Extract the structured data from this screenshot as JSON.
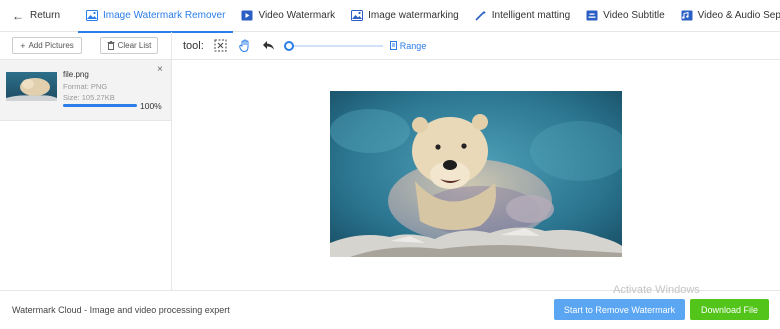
{
  "header": {
    "return_label": "Return",
    "tabs": [
      {
        "label": "Image Watermark Remover",
        "icon": "image-icon",
        "active": true
      },
      {
        "label": "Video Watermark",
        "icon": "video-icon",
        "active": false
      },
      {
        "label": "Image watermarking",
        "icon": "image-icon",
        "active": false
      },
      {
        "label": "Intelligent matting",
        "icon": "magic-wand-icon",
        "active": false
      },
      {
        "label": "Video Subtitle",
        "icon": "subtitle-icon",
        "active": false
      },
      {
        "label": "Video & Audio Separation",
        "icon": "separation-icon",
        "active": false
      }
    ]
  },
  "sidebar": {
    "add_label": "Add Pictures",
    "clear_label": "Clear List",
    "files": [
      {
        "name": "file.png",
        "format": "Format:  PNG",
        "size": "Size:  105.27KB",
        "progress": 1.0,
        "progress_text": "100%"
      }
    ]
  },
  "toolbar": {
    "label": "tool:",
    "tools": [
      "select-box-icon",
      "hand-icon",
      "undo-icon"
    ],
    "slider_value": 0,
    "range_label": "Range"
  },
  "footer": {
    "caption": "Watermark Cloud - Image and video processing expert",
    "remove_label": "Start to Remove Watermark",
    "download_label": "Download File"
  },
  "watermark_text": "Activate Windows",
  "colors": {
    "accent": "#2b7de9",
    "download": "#52c41a",
    "remove": "#5aa6f2"
  }
}
